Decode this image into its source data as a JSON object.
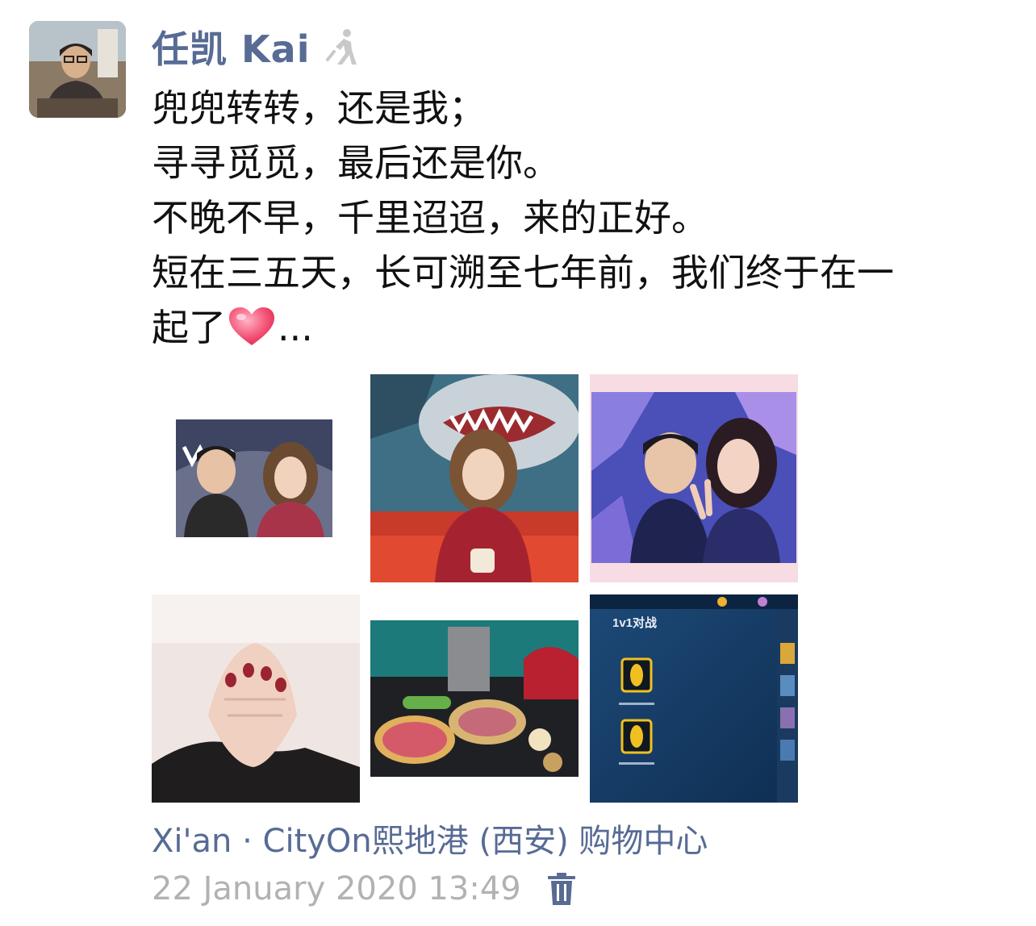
{
  "post": {
    "author": "任凯 Kai",
    "text_lines": [
      "兜兜转转，还是我；",
      "寻寻觅觅，最后还是你。",
      "不晚不早，千里迢迢，来的正好。",
      "短在三五天，长可溯至七年前，我们终于在一",
      "起了"
    ],
    "text_suffix": "...",
    "location": "Xi'an · CityOn熙地港 (西安) 购物中心",
    "timestamp": "22 January 2020 13:49"
  },
  "photos": {
    "game_screen_title": "1v1对战"
  },
  "icons": {
    "walk": "walking-person-icon",
    "heart": "heart-emoji-icon",
    "trash": "trash-icon"
  },
  "colors": {
    "link": "#576b95",
    "timestamp": "#b2b2b2",
    "text": "#111111"
  }
}
